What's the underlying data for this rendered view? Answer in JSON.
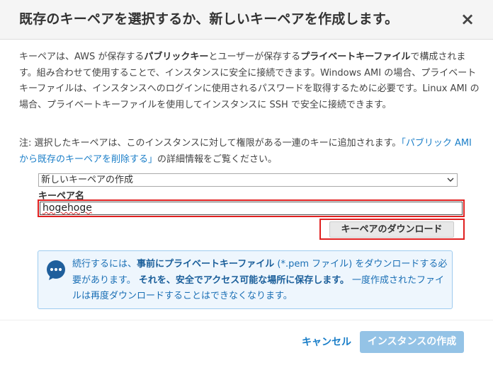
{
  "dialog": {
    "title": "既存のキーペアを選択するか、新しいキーペアを作成します。",
    "close_label": "×"
  },
  "description": {
    "s1": "キーペアは、AWS が保存する",
    "b1": "パブリックキー",
    "s2": "とユーザーが保存する",
    "b2": "プライベートキーファイル",
    "s3": "で構成されます。組み合わせて使用することで、インスタンスに安全に接続できます。Windows AMI の場合、プライベートキーファイルは、インスタンスへのログインに使用されるパスワードを取得するために必要です。Linux AMI の場合、プライベートキーファイルを使用してインスタンスに SSH で安全に接続できます。"
  },
  "note": {
    "s1": "注: 選択したキーペアは、このインスタンスに対して権限がある一連のキーに追加されます。",
    "link": "「パブリック AMI から既存のキーペアを削除する」",
    "s2": "の詳細情報をご覧ください。"
  },
  "keypair_select": {
    "value": "新しいキーペアの作成"
  },
  "keypair_name": {
    "label": "キーペア名",
    "value": "hogehoge"
  },
  "download_button": {
    "label": "キーペアのダウンロード"
  },
  "info": {
    "icon": "speech-bubble-icon",
    "s1": "続行するには、",
    "b1": "事前にプライベートキーファイル",
    "s2": " (*.pem ファイル) をダウンロードする必要があります。",
    "b2": "それを、安全でアクセス可能な場所に保存します。",
    "s3": "一度作成されたファイルは再度ダウンロードすることはできなくなります。"
  },
  "footer": {
    "cancel_label": "キャンセル",
    "create_label": "インスタンスの作成"
  },
  "colors": {
    "link": "#1a7ec8",
    "highlight_border": "#e02020",
    "info_bg": "#eef6fd",
    "info_text": "#1a6fb5",
    "create_disabled": "#94c3e6"
  }
}
